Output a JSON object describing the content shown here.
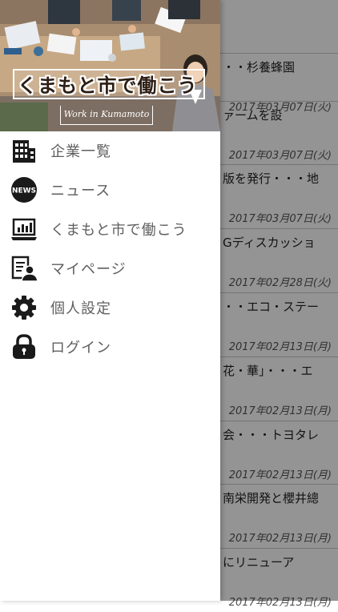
{
  "news_list": [
    {
      "title": "・・杉養蜂園",
      "date": "2017年03月07日(火)"
    },
    {
      "title": "ァームを設",
      "date": "2017年03月07日(火)"
    },
    {
      "title": "版を発行・・・地",
      "date": "2017年03月07日(火)"
    },
    {
      "title": "Gディスカッショ",
      "date": "2017年02月28日(火)"
    },
    {
      "title": "・・エコ・ステー",
      "date": "2017年02月13日(月)"
    },
    {
      "title": "花・華」・・・エ",
      "date": "2017年02月13日(月)"
    },
    {
      "title": "会・・・トヨタレ",
      "date": "2017年02月13日(月)"
    },
    {
      "title": "南栄開発と櫻井總",
      "date": "2017年02月13日(月)"
    },
    {
      "title": "にリニューア",
      "date": "2017年02月13日(月)"
    }
  ],
  "drawer": {
    "banner": {
      "title": "くまもと市で働こう",
      "subtitle": "Work in Kumamoto"
    },
    "menu": [
      {
        "label": "企業一覧",
        "icon": "building-icon"
      },
      {
        "label": "ニュース",
        "icon": "news-icon"
      },
      {
        "label": "くまもと市で働こう",
        "icon": "laptop-chart-icon"
      },
      {
        "label": "マイページ",
        "icon": "user-profile-icon"
      },
      {
        "label": "個人設定",
        "icon": "gear-icon"
      },
      {
        "label": "ログイン",
        "icon": "lock-icon"
      }
    ]
  },
  "colors": {
    "menu_text": "#5f5f5f",
    "icon": "#1a1a1a",
    "overlay": "rgba(0,0,0,0.42)",
    "list_divider": "#c8c8c8"
  }
}
